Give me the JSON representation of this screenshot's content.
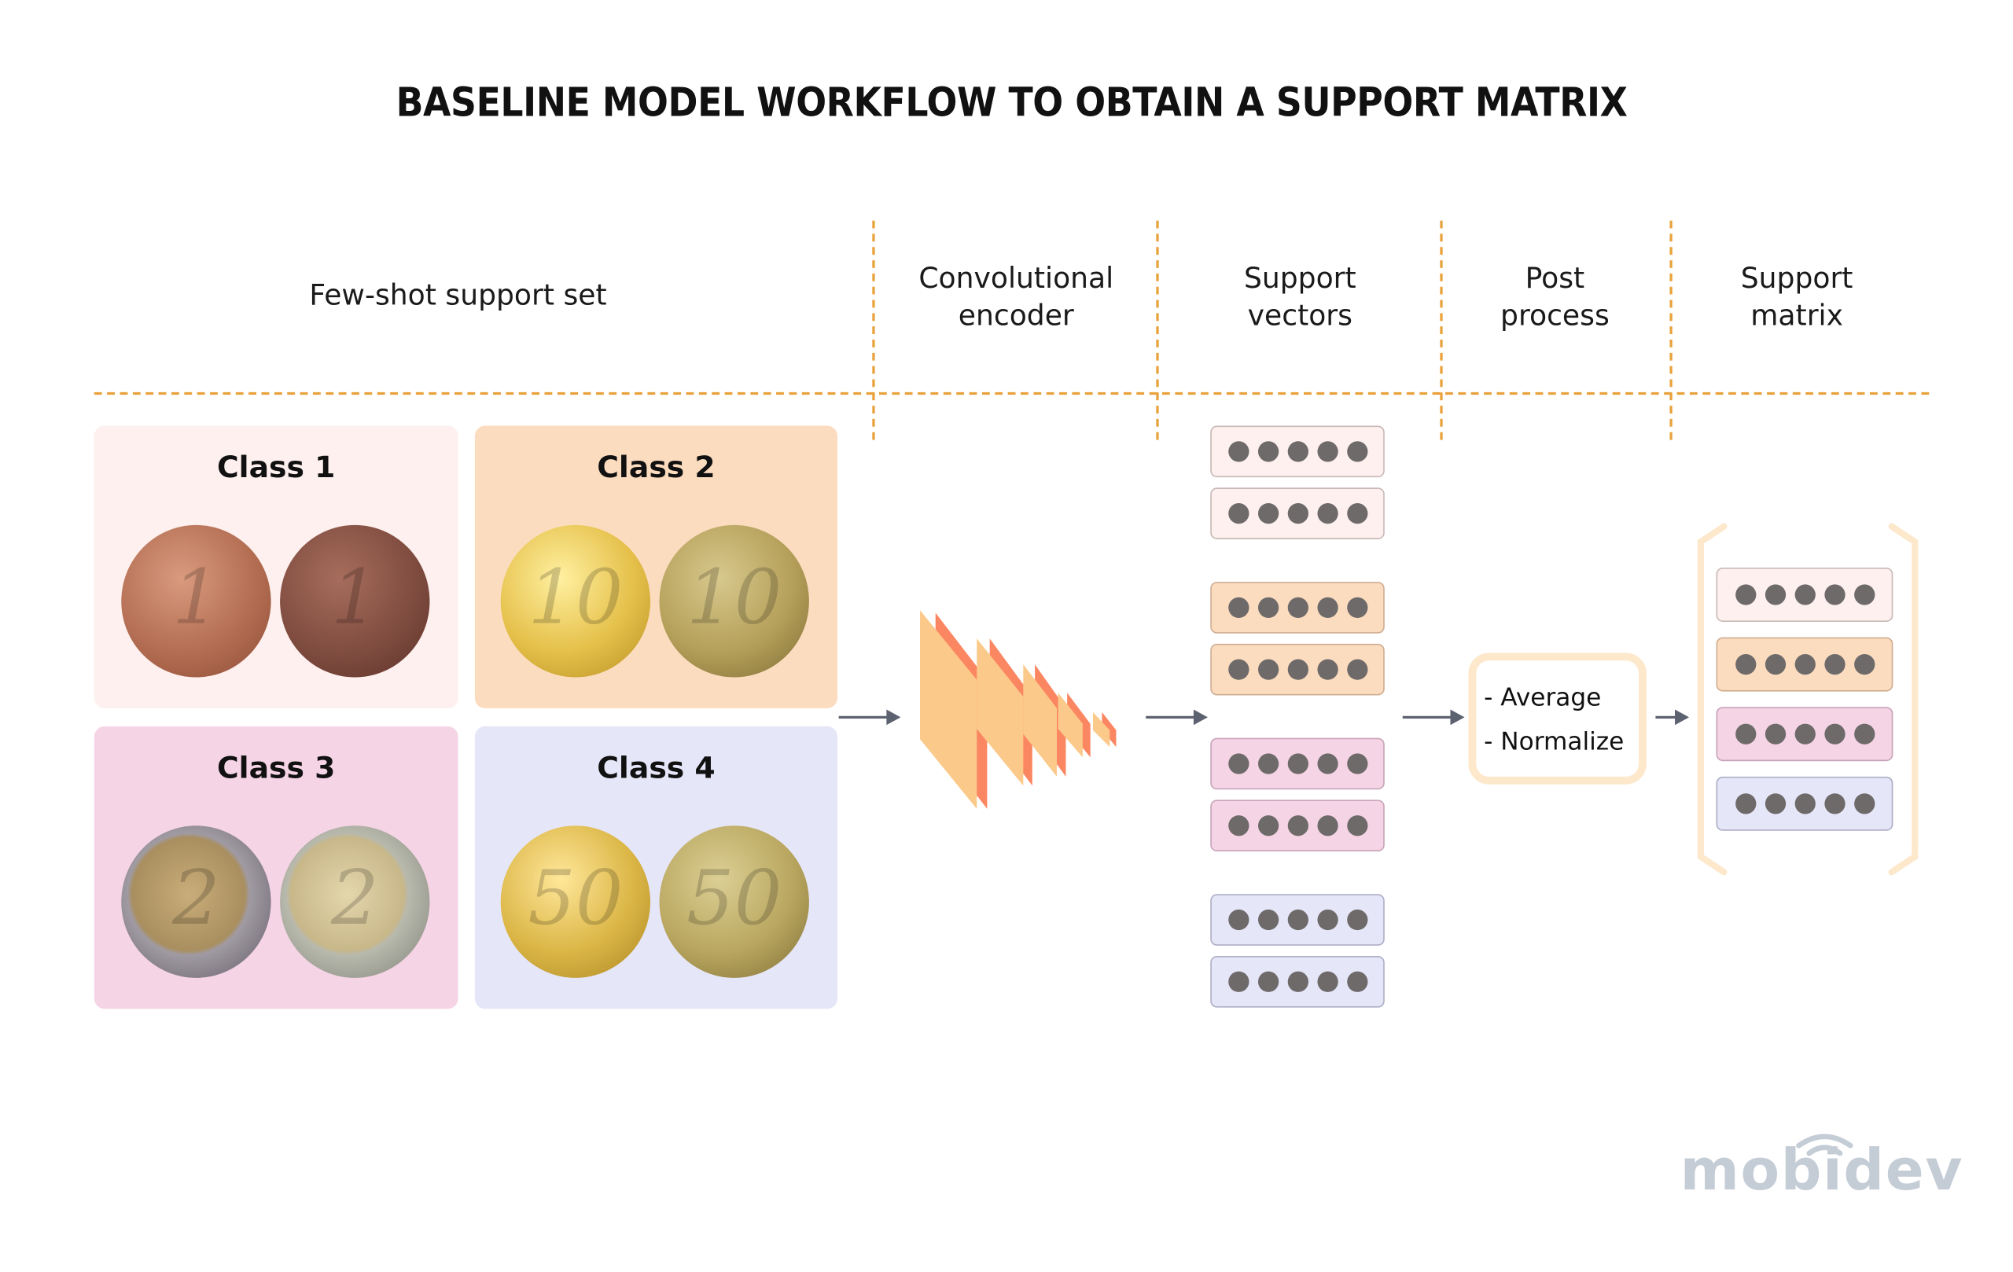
{
  "title": "BASELINE MODEL WORKFLOW TO OBTAIN A SUPPORT MATRIX",
  "columns": {
    "support_set": "Few-shot support set",
    "encoder": [
      "Convolutional",
      "encoder"
    ],
    "vectors": [
      "Support",
      "vectors"
    ],
    "post": [
      "Post",
      "process"
    ],
    "matrix": [
      "Support",
      "matrix"
    ]
  },
  "classes": [
    {
      "label": "Class 1",
      "coin": "1 euro cent",
      "glyph": "1",
      "bg": "#fdf0ee"
    },
    {
      "label": "Class 2",
      "coin": "10 euro cent",
      "glyph": "10",
      "bg": "#fcdcbf"
    },
    {
      "label": "Class 3",
      "coin": "2 euro",
      "glyph": "2",
      "bg": "#f5d4e5"
    },
    {
      "label": "Class 4",
      "coin": "50 euro cent",
      "glyph": "50",
      "bg": "#e6e6f9"
    }
  ],
  "vector_colors": [
    {
      "bg": "#fdf0ee",
      "border": "#c9b9b6"
    },
    {
      "bg": "#fcdcbf",
      "border": "#cfae93"
    },
    {
      "bg": "#f5d4e5",
      "border": "#c8a4b8"
    },
    {
      "bg": "#e6e6f9",
      "border": "#aeaec6"
    }
  ],
  "post_process": {
    "steps": [
      "- Average",
      "- Normalize"
    ]
  },
  "accent_colors": {
    "dash": "#e9a23b",
    "arrow": "#5d6270",
    "encoder_front": "#fbc98a",
    "encoder_side": "#fb8762",
    "bracket": "#fde8cc",
    "dot": "#6e6a6a"
  },
  "logo": "mobidev"
}
